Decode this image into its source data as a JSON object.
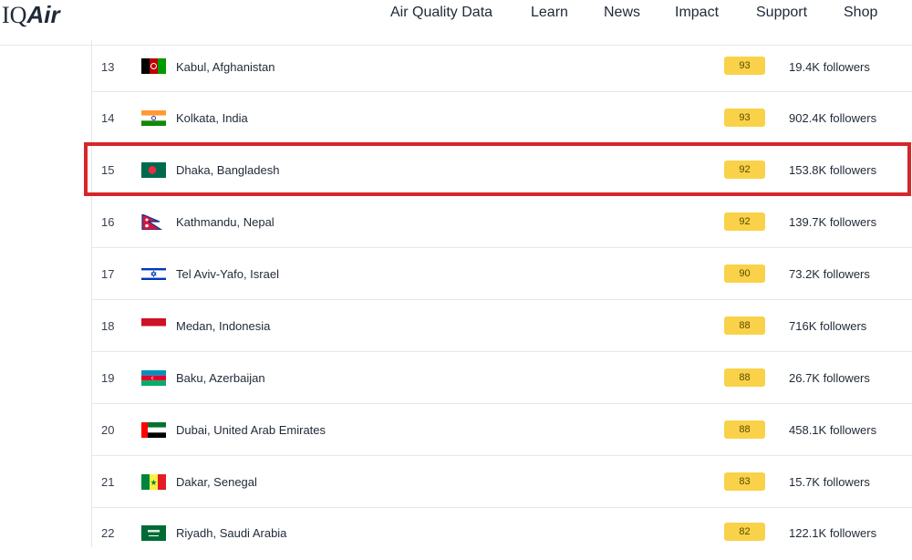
{
  "brand": {
    "logo_iq": "IQ",
    "logo_air": "Air"
  },
  "nav": {
    "items": [
      {
        "label": "Air Quality Data"
      },
      {
        "label": "Learn"
      },
      {
        "label": "News"
      },
      {
        "label": "Impact"
      },
      {
        "label": "Support"
      },
      {
        "label": "Shop"
      }
    ]
  },
  "ranking": {
    "rows": [
      {
        "rank": "13",
        "flag": "afghanistan-flag-icon",
        "city": "Kabul, Afghanistan",
        "aqi": "93",
        "followers": "19.4K followers"
      },
      {
        "rank": "14",
        "flag": "india-flag-icon",
        "city": "Kolkata, India",
        "aqi": "93",
        "followers": "902.4K followers"
      },
      {
        "rank": "15",
        "flag": "bangladesh-flag-icon",
        "city": "Dhaka, Bangladesh",
        "aqi": "92",
        "followers": "153.8K followers"
      },
      {
        "rank": "16",
        "flag": "nepal-flag-icon",
        "city": "Kathmandu, Nepal",
        "aqi": "92",
        "followers": "139.7K followers"
      },
      {
        "rank": "17",
        "flag": "israel-flag-icon",
        "city": "Tel Aviv-Yafo, Israel",
        "aqi": "90",
        "followers": "73.2K followers"
      },
      {
        "rank": "18",
        "flag": "indonesia-flag-icon",
        "city": "Medan, Indonesia",
        "aqi": "88",
        "followers": "716K followers"
      },
      {
        "rank": "19",
        "flag": "azerbaijan-flag-icon",
        "city": "Baku, Azerbaijan",
        "aqi": "88",
        "followers": "26.7K followers"
      },
      {
        "rank": "20",
        "flag": "uae-flag-icon",
        "city": "Dubai, United Arab Emirates",
        "aqi": "88",
        "followers": "458.1K followers"
      },
      {
        "rank": "21",
        "flag": "senegal-flag-icon",
        "city": "Dakar, Senegal",
        "aqi": "83",
        "followers": "15.7K followers"
      },
      {
        "rank": "22",
        "flag": "saudi-arabia-flag-icon",
        "city": "Riyadh, Saudi Arabia",
        "aqi": "82",
        "followers": "122.1K followers"
      }
    ],
    "highlighted_rank": "15"
  },
  "colors": {
    "aqi_badge": "#f9d24a",
    "highlight_border": "#d7262b"
  }
}
